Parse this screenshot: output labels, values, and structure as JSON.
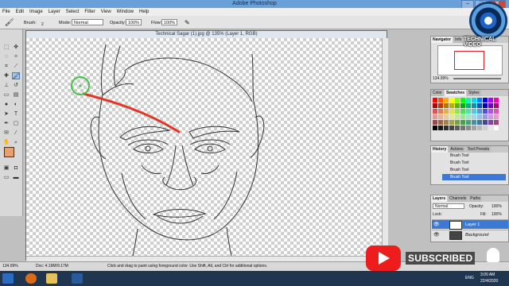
{
  "window": {
    "title": "Adobe Photoshop"
  },
  "menu": [
    "File",
    "Edit",
    "Image",
    "Layer",
    "Select",
    "Filter",
    "View",
    "Window",
    "Help"
  ],
  "options": {
    "brush_label": "Brush:",
    "brush_size": "2",
    "mode_label": "Mode:",
    "mode_value": "Normal",
    "opacity_label": "Opacity:",
    "opacity_value": "100%",
    "flow_label": "Flow:",
    "flow_value": "100%"
  },
  "document": {
    "title": "Technical Sagar (1).jpg @ 135% (Layer 1, RGB)"
  },
  "status": {
    "zoom": "134.99%",
    "doc_size": "Doc: 4.19M/9.17M",
    "hint": "Click and drag to paint using foreground color. Use Shift, Alt, and Ctrl for additional options."
  },
  "navigator": {
    "tabs": [
      "Navigator",
      "Info"
    ],
    "zoom": "134.99%"
  },
  "color_panel": {
    "tabs": [
      "Color",
      "Swatches",
      "Styles"
    ]
  },
  "history_panel": {
    "tabs": [
      "History",
      "Actions",
      "Tool Presets"
    ],
    "items": [
      "Brush Tool",
      "Brush Tool",
      "Brush Tool",
      "Brush Tool"
    ]
  },
  "layers_panel": {
    "tabs": [
      "Layers",
      "Channels",
      "Paths"
    ],
    "blend": "Normal",
    "opacity_label": "Opacity:",
    "opacity_value": "100%",
    "lock_label": "Lock:",
    "fill_label": "Fill:",
    "fill_value": "100%",
    "layers": [
      "Layer 1",
      "Background"
    ]
  },
  "watermark": {
    "text": "TECHNICAL VIDEO"
  },
  "subscribe": {
    "label": "SUBSCRIBED"
  },
  "taskbar": {
    "lang": "ENG",
    "time": "3:00 AM",
    "date": "22/4/2020"
  },
  "colors": {
    "brush_stroke": "#e63324",
    "cursor_ring": "#3ec63e",
    "foreground": "#e8a070",
    "youtube_red": "#ee1c1c",
    "selection": "#3a79d6"
  }
}
